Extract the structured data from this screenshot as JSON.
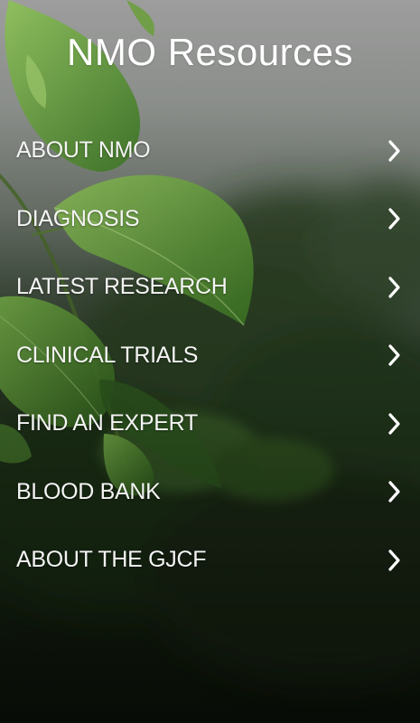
{
  "header": {
    "title": "NMO Resources"
  },
  "menu": {
    "items": [
      {
        "label": "ABOUT NMO",
        "icon": "chevron-right-icon"
      },
      {
        "label": "DIAGNOSIS",
        "icon": "chevron-right-icon"
      },
      {
        "label": "LATEST RESEARCH",
        "icon": "chevron-right-icon"
      },
      {
        "label": "CLINICAL TRIALS",
        "icon": "chevron-right-icon"
      },
      {
        "label": "FIND AN EXPERT",
        "icon": "chevron-right-icon"
      },
      {
        "label": "BLOOD BANK",
        "icon": "chevron-right-icon"
      },
      {
        "label": "ABOUT THE GJCF",
        "icon": "chevron-right-icon"
      }
    ]
  },
  "colors": {
    "text": "#ffffff",
    "leaf": "#5e9a3a",
    "background_top": "#9d9d9d",
    "background_bottom": "#111a0d"
  }
}
